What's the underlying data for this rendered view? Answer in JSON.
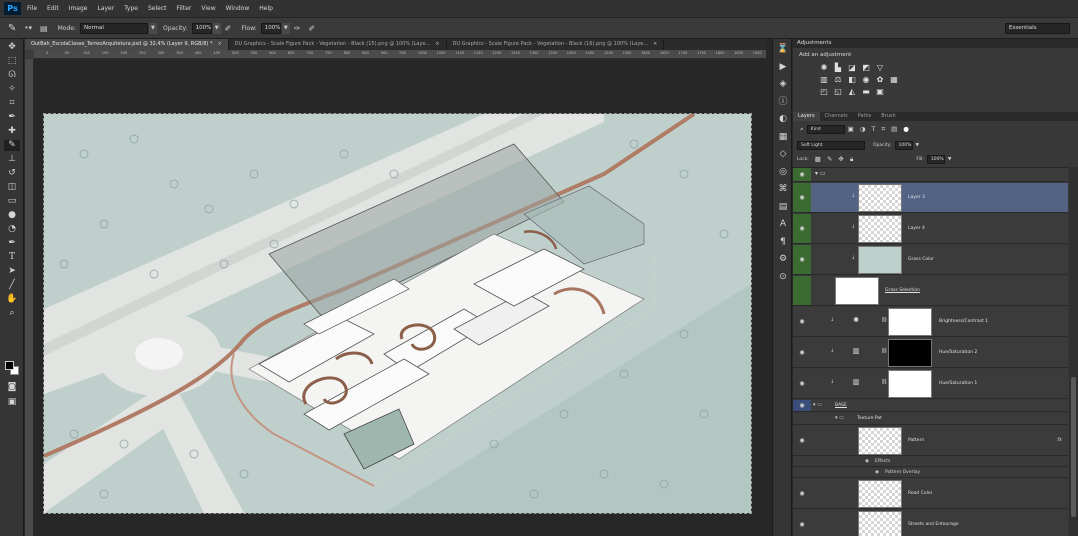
{
  "app": {
    "logo": "Ps"
  },
  "menu": [
    "File",
    "Edit",
    "Image",
    "Layer",
    "Type",
    "Select",
    "Filter",
    "View",
    "Window",
    "Help"
  ],
  "options_bar": {
    "mode_label": "Mode:",
    "mode_value": "Normal",
    "opacity_label": "Opacity:",
    "opacity_value": "100%",
    "flow_label": "Flow:",
    "flow_value": "100%",
    "workspace": "Essentials"
  },
  "doc_tabs": [
    {
      "label": "OutBah_EscolaClasse_TerreoArquitetura.psd @ 32,4% (Layer 9, RGB/8) *",
      "active": true
    },
    {
      "label": "DU Graphics - Scale Figure Pack - Vegetation - Black (15).png @ 100% (Laye...",
      "active": false
    },
    {
      "label": "DU Graphics - Scale Figure Pack - Vegetation - Black (16).png @ 100% (Laye...",
      "active": false
    }
  ],
  "ruler_ticks": [
    "0",
    "50",
    "100",
    "150",
    "200",
    "250",
    "300",
    "350",
    "400",
    "450",
    "500",
    "550",
    "600",
    "650",
    "700",
    "750",
    "800",
    "850",
    "900",
    "950",
    "1000",
    "1050",
    "1100",
    "1150",
    "1200",
    "1250",
    "1300",
    "1350",
    "1400",
    "1450",
    "1500",
    "1550",
    "1600",
    "1650",
    "1700",
    "1750",
    "1800",
    "1850",
    "1900"
  ],
  "adjustments": {
    "header": "Adjustments",
    "title": "Add an adjustment"
  },
  "layers_panel": {
    "tabs": [
      "Layers",
      "Channels",
      "Paths",
      "Brush"
    ],
    "filter_kind": "Kind",
    "blend_mode": "Soft Light",
    "opacity_label": "Opacity:",
    "opacity_value": "100%",
    "lock_label": "Lock:",
    "fill_label": "Fill:",
    "fill_value": "100%",
    "layers": [
      {
        "name": "Layer 3"
      },
      {
        "name": "Layer 4"
      },
      {
        "name": "Grass Color"
      },
      {
        "name": "Grass Selection"
      },
      {
        "name": "Brightness/Contrast 1"
      },
      {
        "name": "Hue/Saturation 2"
      },
      {
        "name": "Hue/Saturation 1"
      },
      {
        "name": "BASE"
      },
      {
        "name": "Texture Pat"
      },
      {
        "name": "Pattern"
      },
      {
        "name": "Effects"
      },
      {
        "name": "Pattern Overlay"
      },
      {
        "name": "Road Color"
      },
      {
        "name": "Streets and Entourage"
      }
    ]
  },
  "colors": {
    "grass": "#bfd0cc",
    "road": "#e3e6e3",
    "path": "#b07c66",
    "selected_layer": "#526383"
  }
}
